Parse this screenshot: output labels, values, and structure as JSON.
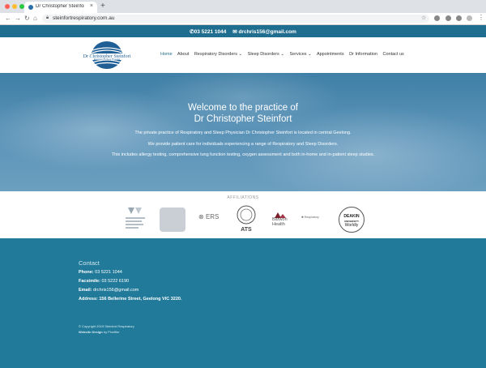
{
  "browser": {
    "tab_title": "Dr Christopher Steinfort Respira",
    "tab_close": "×",
    "new_tab": "+",
    "url": "steinfortrespiratory.com.au",
    "icons": [
      "back-arrow-icon",
      "forward-arrow-icon",
      "reload-icon",
      "home-icon",
      "lock-icon",
      "star-icon",
      "extension-icon",
      "menu-icon"
    ]
  },
  "topbar": {
    "phone": "03 5221 1044",
    "email": "drchris156@gmail.com"
  },
  "logo": {
    "name": "Dr Christopher Steinfort",
    "tagline": "Respiratory & Sleep Physician"
  },
  "nav": {
    "items": [
      "Home",
      "About",
      "Respiratory Disorders ⌄",
      "Sleep Disorders ⌄",
      "Services ⌄",
      "Appointments",
      "Dr Information",
      "Contact us"
    ],
    "active_color": "#1f6d8f"
  },
  "hero": {
    "title_line1": "Welcome to the practice of",
    "title_line2": "Dr Christopher Steinfort",
    "paragraph1": "The private practice of Respiratory and Sleep Physician Dr Christopher Steinfort is located in central Geelong.",
    "paragraph2": "We provide patient care for individuals experiencing a range of Respiratory and Sleep Disorders.",
    "paragraph3": "This includes allergy testing, comprehensive lung function testing, oxygen assessment and both in-home and in-patient sleep studies."
  },
  "affiliations": {
    "title": "AFFILIATIONS",
    "tsanz": "The Thoracic Society of Australia and New Zealand",
    "ers": "ERS",
    "ats": "ATS",
    "barwon": "Barwon Health",
    "resp": "Respiratory",
    "deakin_line1": "DEAKIN",
    "deakin_line2": "UNIVERSITY",
    "deakin_line3": "Worldly"
  },
  "footer": {
    "heading": "Contact",
    "phone_label": "Phone:",
    "phone": "03 5221 1044",
    "fax_label": "Facsimile:",
    "fax": "03 5222 6190",
    "email_label": "Email:",
    "email": "drchris156@gmail.com",
    "address_label": "Address:",
    "address": "156 Bellerine Street, Geelong VIC 3220.",
    "copyright": "© Copyright 2019 Steinfort Respiratory",
    "design_label": "Website Design",
    "design_by": "by Pixelfire"
  },
  "colors": {
    "brand_blue": "#1f6d8f",
    "footer_blue": "#217a99"
  }
}
